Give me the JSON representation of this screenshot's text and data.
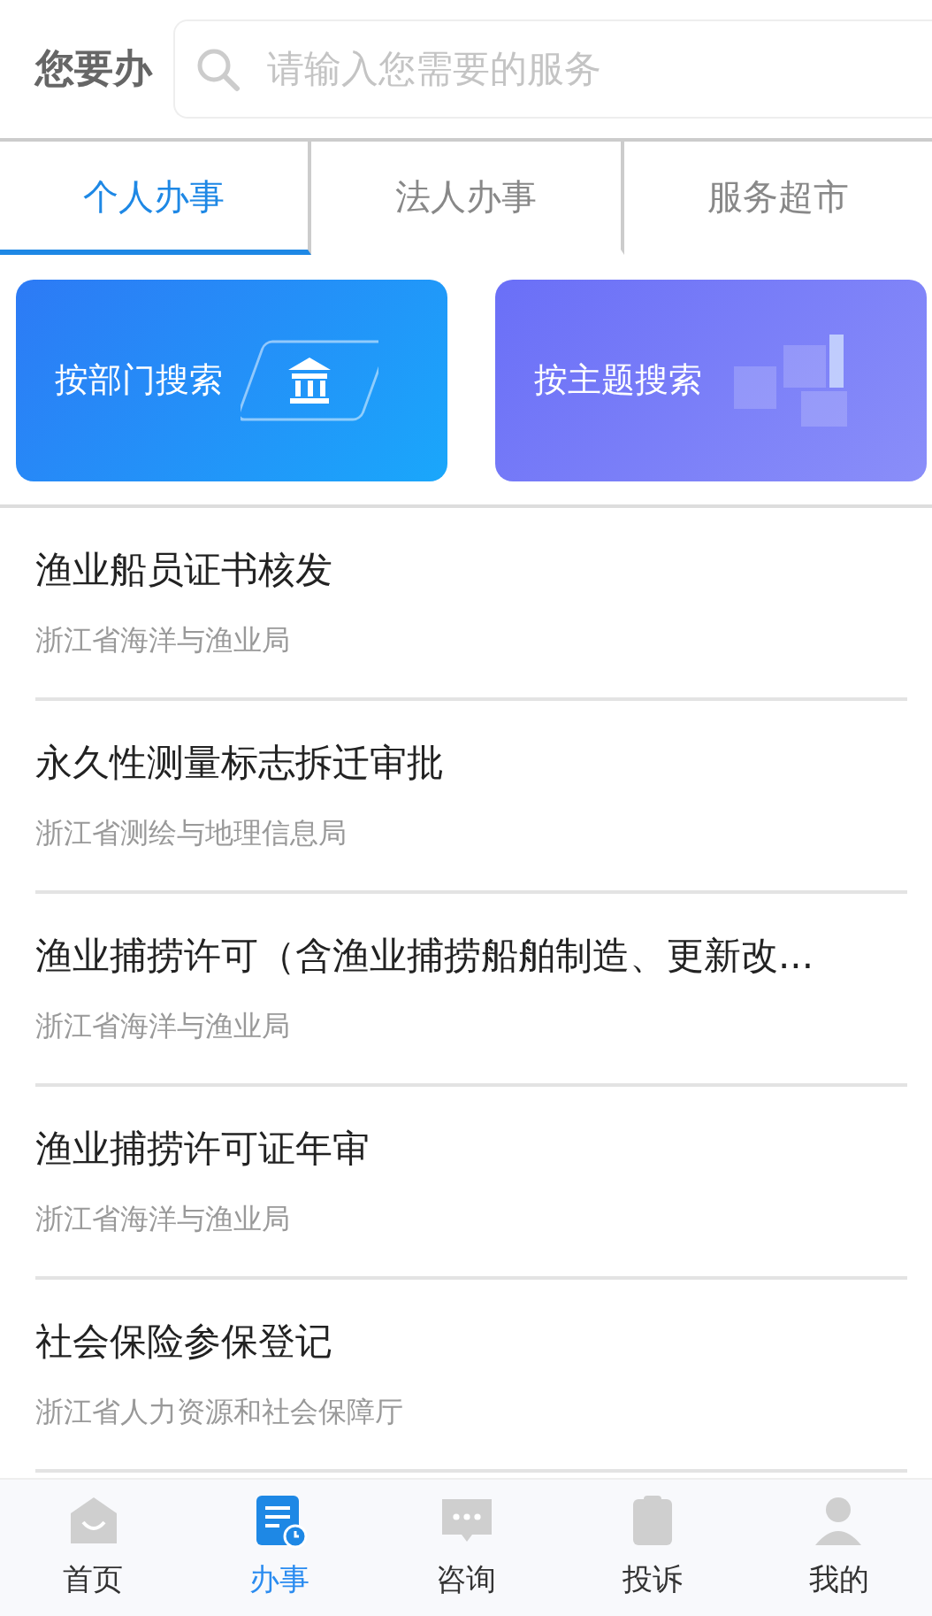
{
  "header": {
    "label": "您要办",
    "search": {
      "placeholder": "请输入您需要的服务"
    }
  },
  "tabs": [
    {
      "label": "个人办事",
      "selected": true
    },
    {
      "label": "法人办事",
      "selected": false
    },
    {
      "label": "服务超市",
      "selected": false
    }
  ],
  "banners": [
    {
      "label": "按部门搜索",
      "kind": "department"
    },
    {
      "label": "按主题搜索",
      "kind": "theme"
    }
  ],
  "services": [
    {
      "title": "渔业船员证书核发",
      "department": "浙江省海洋与渔业局"
    },
    {
      "title": "永久性测量标志拆迁审批",
      "department": "浙江省测绘与地理信息局"
    },
    {
      "title": "渔业捕捞许可（含渔业捕捞船舶制造、更新改...",
      "department": "浙江省海洋与渔业局"
    },
    {
      "title": "渔业捕捞许可证年审",
      "department": "浙江省海洋与渔业局"
    },
    {
      "title": "社会保险参保登记",
      "department": "浙江省人力资源和社会保障厅"
    }
  ],
  "bottom_nav": [
    {
      "label": "首页",
      "kind": "home",
      "selected": false
    },
    {
      "label": "办事",
      "kind": "tasks",
      "selected": true
    },
    {
      "label": "咨询",
      "kind": "chat",
      "selected": false
    },
    {
      "label": "投诉",
      "kind": "complaint",
      "selected": false
    },
    {
      "label": "我的",
      "kind": "profile",
      "selected": false
    }
  ]
}
